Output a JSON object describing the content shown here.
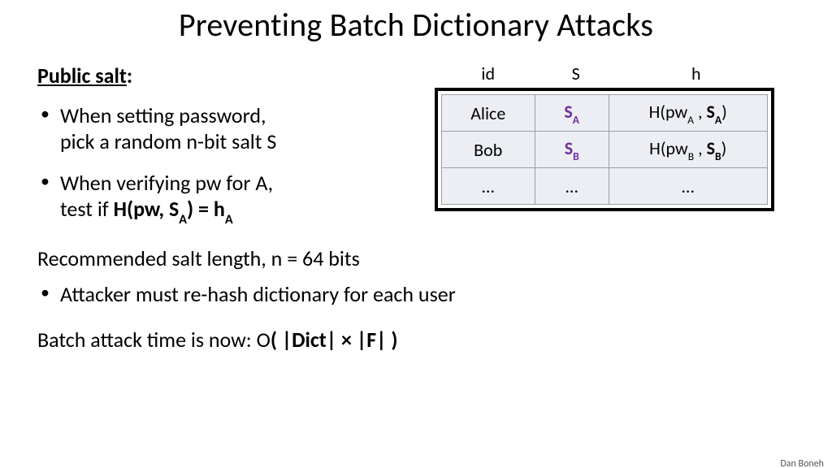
{
  "title": "Preventing Batch Dictionary Attacks",
  "subhead_u": "Public salt",
  "subhead_colon": ":",
  "bullets": {
    "b1a": "When setting password,",
    "b1b": "pick a random n-bit salt  S",
    "b2a": "When verifying pw for A,",
    "b2b_pre": "test if    ",
    "b2b_bold_open": "H(pw, S",
    "b2b_sub": "A",
    "b2b_bold_mid": ") = h",
    "b2b_sub2": "A"
  },
  "lower": {
    "rec": "Recommended salt length,   n = 64 bits",
    "att": "Attacker must re-hash dictionary for each user",
    "batch_pre": "Batch attack time is now:     O",
    "batch_bold": "( |Dict| × |F| )"
  },
  "table": {
    "headers": {
      "id": "id",
      "S": "S",
      "h": "h"
    },
    "rows": [
      {
        "id": "Alice",
        "S_base": "S",
        "S_sub": "A",
        "h_open": "H(pw",
        "h_sub1": "A",
        "h_mid": " , ",
        "h_S": "S",
        "h_sub2": "A",
        "h_close": ")"
      },
      {
        "id": "Bob",
        "S_base": "S",
        "S_sub": "B",
        "h_open": "H(pw",
        "h_sub1": "B",
        "h_mid": " , ",
        "h_S": "S",
        "h_sub2": "B",
        "h_close": ")"
      },
      {
        "id": "…",
        "S_base": "…",
        "S_sub": "",
        "h_open": "…",
        "h_sub1": "",
        "h_mid": "",
        "h_S": "",
        "h_sub2": "",
        "h_close": ""
      }
    ]
  },
  "footer": "Dan Boneh"
}
